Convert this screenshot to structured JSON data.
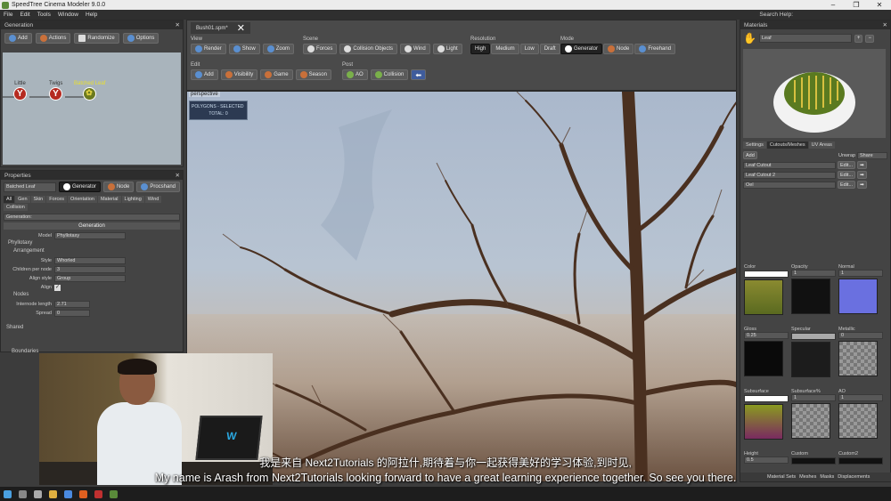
{
  "window": {
    "title": "SpeedTree Cinema Modeler 9.0.0"
  },
  "menu": {
    "items": [
      "File",
      "Edit",
      "Tools",
      "Window",
      "Help"
    ],
    "search_label": "Search Help:"
  },
  "generation_panel": {
    "title": "Generation",
    "buttons": {
      "add": "Add",
      "actions": "Actions",
      "randomize": "Randomize",
      "options": "Options"
    },
    "nodes": {
      "little": "Little",
      "twigs": "Twigs",
      "batched_leaf": "Batched Leaf"
    }
  },
  "properties_panel": {
    "title": "Properties",
    "object_name": "Batched Leaf",
    "mode_buttons": {
      "generator": "Generator",
      "node": "Node",
      "procshand": "Procshand"
    },
    "tabs": [
      "All",
      "Gen",
      "Skin",
      "Forces",
      "Orientation",
      "Material",
      "Lighting",
      "Wind",
      "Collision"
    ],
    "filter_label": "Generation:",
    "section": "Generation",
    "model_label": "Model",
    "model_value": "Phyllotaxy",
    "group_phyllotaxy": "Phyllotaxy",
    "group_arrangement": "Arrangement",
    "style_label": "Style",
    "style_value": "Whorled",
    "children_label": "Children per node",
    "children_value": "3",
    "align_style_label": "Align style",
    "align_style_value": "Group",
    "align_label": "Align",
    "group_nodes": "Nodes",
    "internode_label": "Internode length",
    "internode_value": "2.71",
    "spread_label": "Spread",
    "spread_value": "0",
    "shared_label": "Shared",
    "boundaries_label": "Boundaries"
  },
  "document": {
    "tab_label": "Bush01.spm*"
  },
  "toolbar": {
    "view": {
      "label": "View",
      "render": "Render",
      "show": "Show",
      "zoom": "Zoom"
    },
    "scene": {
      "label": "Scene",
      "forces": "Forces",
      "collision_objects": "Collision Objects",
      "wind": "Wind",
      "light": "Light"
    },
    "resolution": {
      "label": "Resolution",
      "high": "High",
      "medium": "Medium",
      "low": "Low",
      "draft": "Draft"
    },
    "mode": {
      "label": "Mode",
      "generator": "Generator",
      "node": "Node",
      "freehand": "Freehand"
    },
    "edit": {
      "label": "Edit",
      "add": "Add",
      "visibility": "Visibility",
      "game": "Game",
      "season": "Season"
    },
    "post": {
      "label": "Post",
      "ao": "AO",
      "collision": "Collision"
    }
  },
  "viewport": {
    "camera_label": "perspective",
    "polygons_header": "POLYGONS - SELECTED",
    "total_label": "TOTAL: 0"
  },
  "materials_panel": {
    "title": "Materials",
    "material_name": "Leaf",
    "tabs": [
      "Settings",
      "Cutouts/Meshes",
      "UV Areas"
    ],
    "add_button": "Add",
    "unwrap_label": "Unwrap",
    "unwrap_value": "Share",
    "cutouts": [
      "Leaf Cutout",
      "Leaf Cutout 2",
      "Oel"
    ],
    "edit_label": "Edit...",
    "slots": {
      "color": "Color",
      "opacity": "Opacity",
      "opacity_val": "1",
      "normal": "Normal",
      "normal_val": "1",
      "gloss": "Gloss",
      "gloss_val": "0.25",
      "specular": "Specular",
      "metallic": "Metallic",
      "metallic_val": "0",
      "subsurface": "Subsurface",
      "subsurface_pct": "Subsurface%",
      "subsurface_pct_val": "1",
      "ao": "AO",
      "ao_val": "1",
      "height": "Height",
      "height_val": "0.5",
      "custom": "Custom",
      "custom2": "Custom2"
    },
    "bottom_tabs": [
      "Material Sets",
      "Meshes",
      "Masks",
      "Displacements"
    ]
  },
  "subtitles": {
    "chinese": "我是来自 Next2Tutorials 的阿拉什,期待着与你一起获得美好的学习体验,到时见,",
    "english": "My name is Arash from Next2Tutorials looking forward to have a great learning experience together. So see you there."
  },
  "colors": {
    "panel_bg": "#444444",
    "accent_blue": "#5a8fd0",
    "accent_orange": "#c9703a",
    "leaf_yellow": "#e8e030"
  }
}
